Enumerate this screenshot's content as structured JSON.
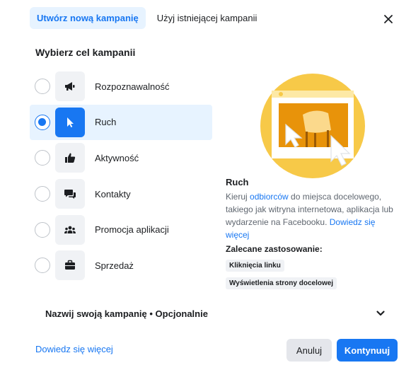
{
  "tabs": {
    "create_new": "Utwórz nową kampanię",
    "use_existing": "Użyj istniejącej kampanii"
  },
  "section_title": "Wybierz cel kampanii",
  "objectives": [
    {
      "label": "Rozpoznawalność",
      "icon": "megaphone-icon",
      "selected": false
    },
    {
      "label": "Ruch",
      "icon": "cursor-icon",
      "selected": true
    },
    {
      "label": "Aktywność",
      "icon": "thumbs-up-icon",
      "selected": false
    },
    {
      "label": "Kontakty",
      "icon": "chat-bubbles-icon",
      "selected": false
    },
    {
      "label": "Promocja aplikacji",
      "icon": "people-icon",
      "selected": false
    },
    {
      "label": "Sprzedaż",
      "icon": "briefcase-icon",
      "selected": false
    }
  ],
  "detail": {
    "title": "Ruch",
    "desc_before_link": "Kieruj ",
    "desc_link": "odbiorców",
    "desc_after_link": " do miejsca docelowego, takiego jak witryna internetowa, aplikacja lub wydarzenie na Facebooku. ",
    "learn_more": "Dowiedz się więcej",
    "recommended_title": "Zalecane zastosowanie:",
    "tags": [
      "Kliknięcia linku",
      "Wyświetlenia strony docelowej"
    ]
  },
  "campaign_name": {
    "label": "Nazwij swoją kampanię • Opcjonalnie"
  },
  "footer": {
    "learn_more": "Dowiedz się więcej",
    "cancel": "Anuluj",
    "continue": "Kontynuuj"
  },
  "colors": {
    "accent": "#1877f2",
    "selected_bg": "#e7f3ff",
    "illustration_yellow": "#f7c948"
  }
}
